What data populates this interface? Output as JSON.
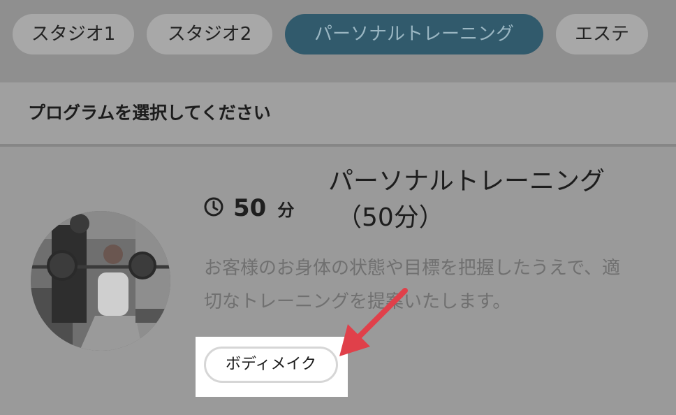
{
  "tabs": [
    {
      "label": "スタジオ1",
      "active": false
    },
    {
      "label": "スタジオ2",
      "active": false
    },
    {
      "label": "パーソナルトレーニング",
      "active": true
    },
    {
      "label": "エステ",
      "active": false
    }
  ],
  "section": {
    "title": "プログラムを選択してください"
  },
  "program": {
    "image_alt": "personal-training-photo",
    "duration_icon": "clock-icon",
    "duration_value": "50",
    "duration_unit": "分",
    "title_line1": "パーソナルトレーニング",
    "title_line2": "（50分）",
    "description": "お客様のお身体の状態や目標を把握したうえで、適切なトレーニングを提案いたします。",
    "tag": "ボディメイク"
  },
  "annotation": {
    "arrow_color": "#e0404a"
  },
  "colors": {
    "active_tab": "#315a6c",
    "overlay": "#9a9a9a"
  }
}
